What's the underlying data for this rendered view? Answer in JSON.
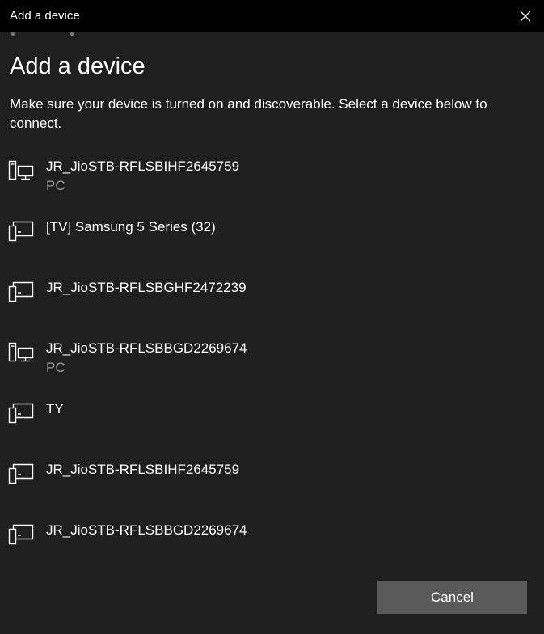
{
  "window": {
    "title": "Add a device"
  },
  "main": {
    "heading": "Add a device",
    "description": "Make sure your device is turned on and discoverable. Select a device below to connect."
  },
  "devices": [
    {
      "name": "JR_JioSTB-RFLSBIHF2645759",
      "type": "PC",
      "icon": "pc-icon"
    },
    {
      "name": "[TV] Samsung 5 Series (32)",
      "type": "",
      "icon": "display-device-icon"
    },
    {
      "name": "JR_JioSTB-RFLSBGHF2472239",
      "type": "",
      "icon": "display-device-icon"
    },
    {
      "name": "JR_JioSTB-RFLSBBGD2269674",
      "type": "PC",
      "icon": "pc-icon"
    },
    {
      "name": "TY",
      "type": "",
      "icon": "display-device-icon"
    },
    {
      "name": "JR_JioSTB-RFLSBIHF2645759",
      "type": "",
      "icon": "display-device-icon"
    },
    {
      "name": "JR_JioSTB-RFLSBBGD2269674",
      "type": "",
      "icon": "display-device-icon"
    }
  ],
  "footer": {
    "cancel_label": "Cancel"
  },
  "colors": {
    "background": "#1f1f1f",
    "titlebar": "#000000",
    "secondary_text": "#9a9a9a",
    "button": "#5a5a5a"
  }
}
